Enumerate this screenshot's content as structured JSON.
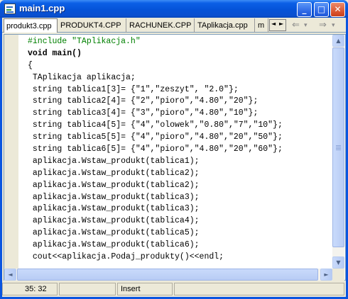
{
  "window": {
    "title": "main1.cpp"
  },
  "title_buttons": {
    "minimize": "_",
    "maximize": "□",
    "close": "✕"
  },
  "tabs": [
    {
      "label": "produkt3.cpp"
    },
    {
      "label": "PRODUKT4.CPP"
    },
    {
      "label": "RACHUNEK.CPP"
    },
    {
      "label": "TAplikacja.cpp"
    },
    {
      "label": "m"
    }
  ],
  "tab_arrows": {
    "left": "◄",
    "right": "►"
  },
  "nav": {
    "back": "⇐",
    "back_menu": "▾",
    "forward": "⇒",
    "forward_menu": "▾"
  },
  "code_lines": [
    "#include \"TAplikacja.h\"",
    "void main()",
    "{",
    " TAplikacja aplikacja;",
    " string tablica1[3]= {\"1\",\"zeszyt\", \"2.0\"};",
    " string tablica2[4]= {\"2\",\"pioro\",\"4.80\",\"20\"};",
    " string tablica3[4]= {\"3\",\"pioro\",\"4.80\",\"10\"};",
    " string tablica4[5]= {\"4\",\"olowek\",\"0.80\",\"7\",\"10\"};",
    " string tablica5[5]= {\"4\",\"pioro\",\"4.80\",\"20\",\"50\"};",
    " string tablica6[5]= {\"4\",\"pioro\",\"4.80\",\"20\",\"60\"};",
    " aplikacja.Wstaw_produkt(tablica1);",
    " aplikacja.Wstaw_produkt(tablica2);",
    " aplikacja.Wstaw_produkt(tablica2);",
    " aplikacja.Wstaw_produkt(tablica3);",
    " aplikacja.Wstaw_produkt(tablica3);",
    " aplikacja.Wstaw_produkt(tablica4);",
    " aplikacja.Wstaw_produkt(tablica5);",
    " aplikacja.Wstaw_produkt(tablica6);",
    " cout<<aplikacja.Podaj_produkty()<<endl;"
  ],
  "scroll_arrows": {
    "up": "▲",
    "down": "▼",
    "left": "◄",
    "right": "►"
  },
  "status": {
    "position": "35: 32",
    "modified": "",
    "mode": "Insert",
    "extra": ""
  },
  "colors": {
    "titlebar": "#0553d8",
    "preprocessor": "#008000",
    "background": "#ece9d8"
  },
  "icons": [
    "app-icon",
    "minimize-icon",
    "maximize-icon",
    "close-icon",
    "back-arrow-icon",
    "forward-arrow-icon"
  ]
}
